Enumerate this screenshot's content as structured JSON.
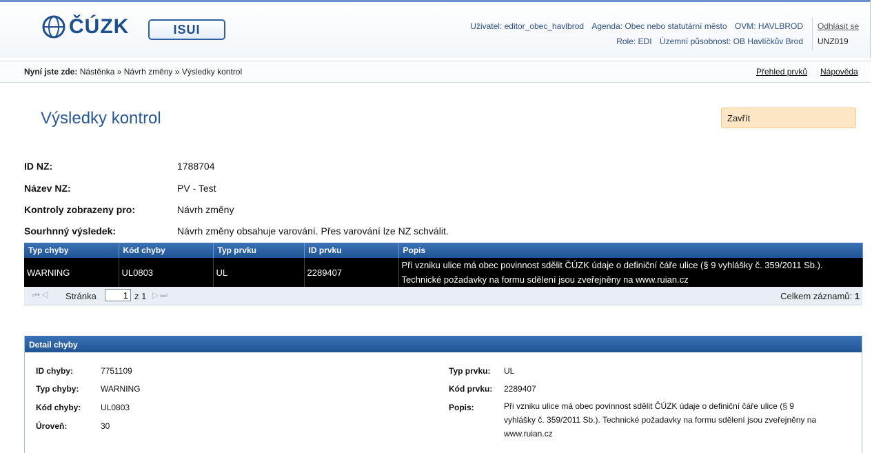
{
  "header": {
    "logo_text": "ČÚZK",
    "app_logo_text": "ISUI",
    "user_label": "Uživatel: editor_obec_havlbrod",
    "agenda_label": "Agenda: Obec nebo statutární město",
    "ovm_label": "OVM: HAVLBROD",
    "role_label": "Role: EDI",
    "territory_label": "Územní působnost: OB Havlíčkův Brod",
    "logout_label": "Odhlásit se",
    "code": "UNZ019"
  },
  "breadcrumb": {
    "prefix": "Nyní jste zde:",
    "path": "Nástěnka » Návrh změny » Výsledky kontrol"
  },
  "top_links": {
    "overview": "Přehled prvků",
    "help": "Nápověda"
  },
  "page": {
    "title": "Výsledky kontrol",
    "close_label": "Zavřít"
  },
  "info": [
    {
      "label": "ID NZ:",
      "value": "1788704"
    },
    {
      "label": "Název NZ:",
      "value": "PV - Test"
    },
    {
      "label": "Kontroly zobrazeny pro:",
      "value": "Návrh změny"
    },
    {
      "label": "Sourhnný výsledek:",
      "value": "Návrh změny obsahuje varování. Přes varování lze NZ schválit."
    }
  ],
  "grid": {
    "columns": [
      "Typ chyby",
      "Kód chyby",
      "Typ prvku",
      "ID prvku",
      "Popis"
    ],
    "rows": [
      {
        "typ_chyby": "WARNING",
        "kod_chyby": "UL0803",
        "typ_prvku": "UL",
        "id_prvku": "2289407",
        "popis": "Při vzniku ulice má obec povinnost sdělit ČÚZK údaje o definiční čáře ulice (§ 9 vyhlášky č. 359/2011 Sb.). Technické požadavky na formu sdělení jsou zveřejněny na www.ruian.cz"
      }
    ],
    "pager": {
      "page_label": "Stránka",
      "page_value": "1",
      "of_label": "z 1",
      "total_label": "Celkem záznamů:",
      "total_value": "1"
    }
  },
  "detail": {
    "title": "Detail chyby",
    "left": [
      {
        "label": "ID chyby:",
        "value": "7751109"
      },
      {
        "label": "Typ chyby:",
        "value": "WARNING"
      },
      {
        "label": "Kód chyby:",
        "value": "UL0803"
      },
      {
        "label": "Úroveň:",
        "value": "30"
      }
    ],
    "right": [
      {
        "label": "Typ prvku:",
        "value": "UL"
      },
      {
        "label": "Kód prvku:",
        "value": "2289407"
      }
    ],
    "popis_label": "Popis:",
    "popis_value": "Při vzniku ulice má obec povinnost sdělit ČÚZK údaje o definiční čáře ulice (§ 9 vyhlášky č. 359/2011 Sb.). Technické požadavky na formu sdělení jsou zveřejněny na www.ruian.cz"
  },
  "colors": {
    "header_blue": "#2a578f",
    "grid_header": "#1f5394",
    "selected_row": "#000000",
    "close_button": "#fde6c6"
  }
}
